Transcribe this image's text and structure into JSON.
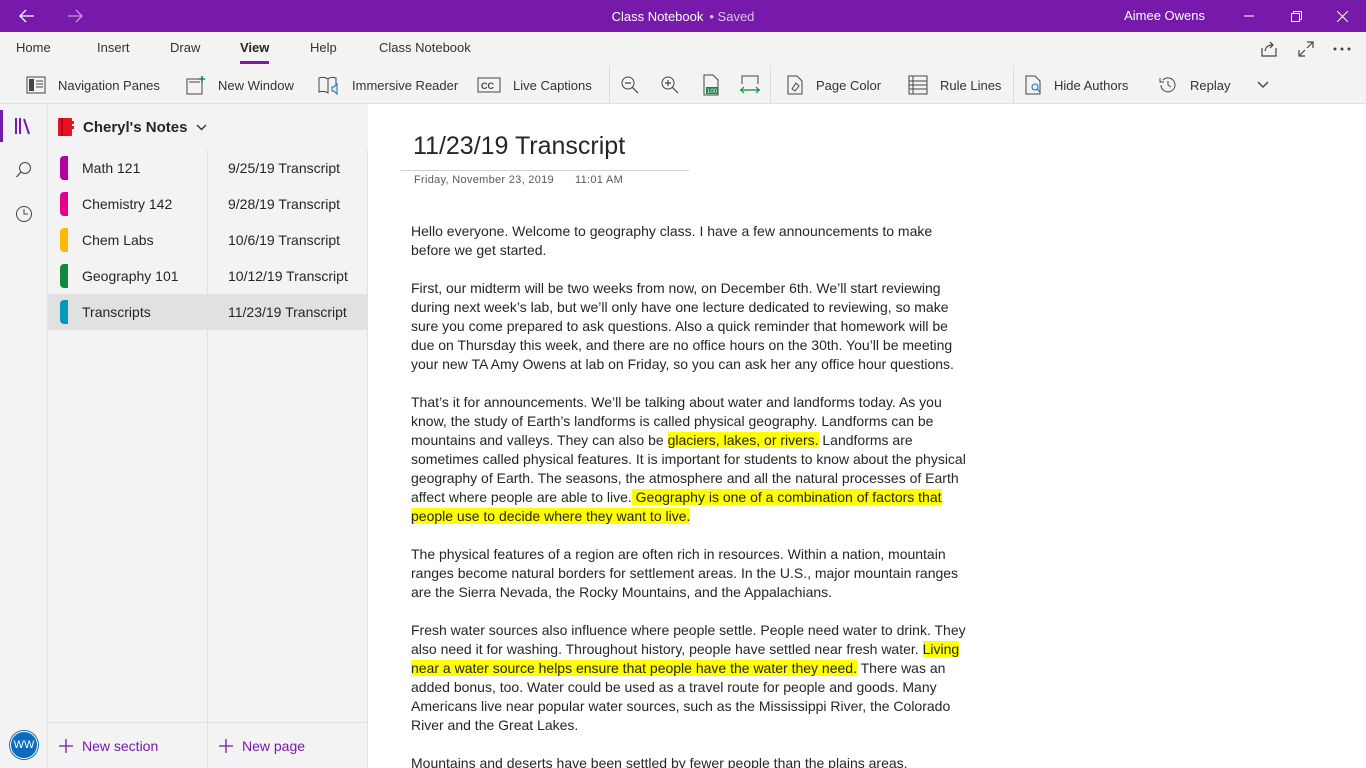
{
  "titlebar": {
    "title": "Class Notebook",
    "status": "• Saved",
    "user": "Aimee Owens"
  },
  "ribbon_tabs": [
    "Home",
    "Insert",
    "Draw",
    "View",
    "Help",
    "Class Notebook"
  ],
  "active_tab": "View",
  "ribbon": {
    "navigation_panes": "Navigation Panes",
    "new_window": "New Window",
    "immersive_reader": "Immersive Reader",
    "live_captions": "Live Captions",
    "page_color": "Page Color",
    "rule_lines": "Rule Lines",
    "hide_authors": "Hide Authors",
    "replay": "Replay"
  },
  "notebook": {
    "name": "Cheryl's Notes",
    "sections": [
      {
        "label": "Math 121",
        "color": "#b4009e"
      },
      {
        "label": "Chemistry 142",
        "color": "#e3008c"
      },
      {
        "label": "Chem Labs",
        "color": "#ffb900"
      },
      {
        "label": "Geography 101",
        "color": "#10893e"
      },
      {
        "label": "Transcripts",
        "color": "#0099bc"
      }
    ],
    "pages": [
      "9/25/19 Transcript",
      "9/28/19 Transcript",
      "10/6/19 Transcript",
      "10/12/19 Transcript",
      "11/23/19 Transcript"
    ],
    "new_section": "New section",
    "new_page": "New page"
  },
  "user_initials": "WW",
  "page": {
    "title": "11/23/19 Transcript",
    "date": "Friday, November 23, 2019",
    "time": "11:01 AM",
    "p1": "Hello everyone. Welcome to geography class. I have a few announcements to make before we get started.",
    "p2": "First, our midterm will be two weeks from now, on December 6th. We’ll start reviewing during next week’s lab, but we’ll only have one lecture dedicated to reviewing, so make sure you come prepared to ask questions. Also a quick reminder that homework will be due on Thursday this week, and there are no office hours on the 30th. You’ll be meeting your new TA Amy Owens at lab on Friday, so you can ask her any office hour questions.",
    "p3a": "That’s it for announcements. We’ll be talking about water and landforms today. As you know, the study of Earth’s landforms is called physical geography. Landforms can be mountains and valleys. They can also be ",
    "p3b": "glaciers, lakes, or rivers.",
    "p3c": " Landforms are sometimes called physical features. It is important for students to know about the physical geography of Earth. The seasons, the atmosphere and all the natural processes of Earth affect where people are able to live.",
    "p3d": " Geography is one of a combination of factors that people use to decide where they want to live.",
    "p4": "The physical features of a region are often rich in resources. Within a nation, mountain ranges become natural borders for settlement areas. In the U.S., major mountain ranges are the Sierra Nevada, the Rocky Mountains, and the Appalachians.",
    "p5a": "Fresh water sources also influence where people settle. People need water to drink. They also need it for washing. Throughout history, people have settled near fresh water. ",
    "p5b": "Living near a water source helps ensure that people have the water they need.",
    "p5c": " There was an added bonus, too. Water could be used as a travel route for people and goods. Many Americans live near popular water sources, such as the Mississippi River, the Colorado River and the Great Lakes.",
    "p6": "Mountains and deserts have been settled by fewer people than the plains areas."
  },
  "colors": {
    "accent": "#7719aa",
    "highlight": "#ffff00",
    "avatar": "#0f6cbd"
  }
}
